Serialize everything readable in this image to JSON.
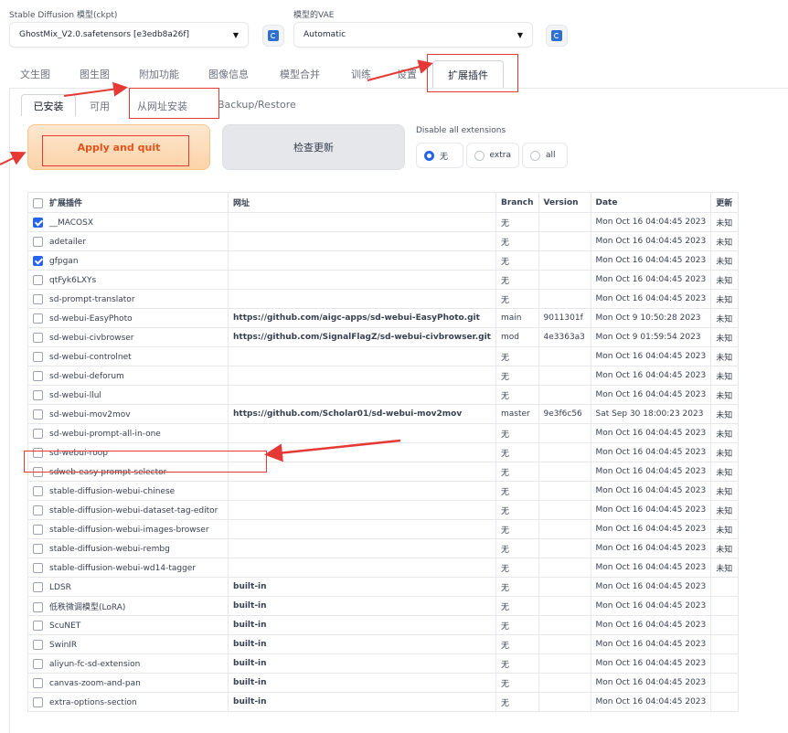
{
  "model_section": {
    "checkpoint_label": "Stable Diffusion 模型(ckpt)",
    "checkpoint_value": "GhostMix_V2.0.safetensors [e3edb8a26f]",
    "vae_label": "模型的VAE",
    "vae_value": "Automatic"
  },
  "main_tabs": [
    "文生图",
    "图生图",
    "附加功能",
    "图像信息",
    "模型合并",
    "训练",
    "设置",
    "扩展插件"
  ],
  "sub_tabs": [
    "已安装",
    "可用",
    "从网址安装",
    "Backup/Restore"
  ],
  "actions": {
    "apply_label": "Apply and quit",
    "check_label": "检查更新"
  },
  "disable_all": {
    "label": "Disable all extensions",
    "options": [
      "无",
      "extra",
      "all"
    ],
    "selected": "无"
  },
  "table": {
    "headers": [
      "扩展插件",
      "网址",
      "Branch",
      "Version",
      "Date",
      "更新"
    ],
    "rows": [
      {
        "name": "__MACOSX",
        "checked": true,
        "url": "",
        "branch": "无",
        "version": "",
        "date": "Mon Oct 16 04:04:45 2023",
        "update": "未知"
      },
      {
        "name": "adetailer",
        "checked": false,
        "url": "",
        "branch": "无",
        "version": "",
        "date": "Mon Oct 16 04:04:45 2023",
        "update": "未知"
      },
      {
        "name": "gfpgan",
        "checked": true,
        "url": "",
        "branch": "无",
        "version": "",
        "date": "Mon Oct 16 04:04:45 2023",
        "update": "未知"
      },
      {
        "name": "qtFyk6LXYs",
        "checked": false,
        "url": "",
        "branch": "无",
        "version": "",
        "date": "Mon Oct 16 04:04:45 2023",
        "update": "未知"
      },
      {
        "name": "sd-prompt-translator",
        "checked": false,
        "url": "",
        "branch": "无",
        "version": "",
        "date": "Mon Oct 16 04:04:45 2023",
        "update": "未知"
      },
      {
        "name": "sd-webui-EasyPhoto",
        "checked": false,
        "url": "https://github.com/aigc-apps/sd-webui-EasyPhoto.git",
        "branch": "main",
        "version": "9011301f",
        "date": "Mon Oct 9 10:50:28 2023",
        "update": "未知"
      },
      {
        "name": "sd-webui-civbrowser",
        "checked": false,
        "url": "https://github.com/SignalFlagZ/sd-webui-civbrowser.git",
        "branch": "mod",
        "version": "4e3363a3",
        "date": "Mon Oct 9 01:59:54 2023",
        "update": "未知"
      },
      {
        "name": "sd-webui-controlnet",
        "checked": false,
        "url": "",
        "branch": "无",
        "version": "",
        "date": "Mon Oct 16 04:04:45 2023",
        "update": "未知"
      },
      {
        "name": "sd-webui-deforum",
        "checked": false,
        "url": "",
        "branch": "无",
        "version": "",
        "date": "Mon Oct 16 04:04:45 2023",
        "update": "未知"
      },
      {
        "name": "sd-webui-llul",
        "checked": false,
        "url": "",
        "branch": "无",
        "version": "",
        "date": "Mon Oct 16 04:04:45 2023",
        "update": "未知"
      },
      {
        "name": "sd-webui-mov2mov",
        "checked": false,
        "url": "https://github.com/Scholar01/sd-webui-mov2mov",
        "branch": "master",
        "version": "9e3f6c56",
        "date": "Sat Sep 30 18:00:23 2023",
        "update": "未知"
      },
      {
        "name": "sd-webui-prompt-all-in-one",
        "checked": false,
        "url": "",
        "branch": "无",
        "version": "",
        "date": "Mon Oct 16 04:04:45 2023",
        "update": "未知"
      },
      {
        "name": "sd-webui-roop",
        "checked": false,
        "url": "",
        "branch": "无",
        "version": "",
        "date": "Mon Oct 16 04:04:45 2023",
        "update": "未知"
      },
      {
        "name": "sdweb-easy-prompt-selector",
        "checked": false,
        "url": "",
        "branch": "无",
        "version": "",
        "date": "Mon Oct 16 04:04:45 2023",
        "update": "未知"
      },
      {
        "name": "stable-diffusion-webui-chinese",
        "checked": false,
        "url": "",
        "branch": "无",
        "version": "",
        "date": "Mon Oct 16 04:04:45 2023",
        "update": "未知"
      },
      {
        "name": "stable-diffusion-webui-dataset-tag-editor",
        "checked": false,
        "url": "",
        "branch": "无",
        "version": "",
        "date": "Mon Oct 16 04:04:45 2023",
        "update": "未知"
      },
      {
        "name": "stable-diffusion-webui-images-browser",
        "checked": false,
        "url": "",
        "branch": "无",
        "version": "",
        "date": "Mon Oct 16 04:04:45 2023",
        "update": "未知"
      },
      {
        "name": "stable-diffusion-webui-rembg",
        "checked": false,
        "url": "",
        "branch": "无",
        "version": "",
        "date": "Mon Oct 16 04:04:45 2023",
        "update": "未知"
      },
      {
        "name": "stable-diffusion-webui-wd14-tagger",
        "checked": false,
        "url": "",
        "branch": "无",
        "version": "",
        "date": "Mon Oct 16 04:04:45 2023",
        "update": "未知"
      },
      {
        "name": "LDSR",
        "checked": false,
        "url": "built-in",
        "branch": "无",
        "version": "",
        "date": "Mon Oct 16 04:04:45 2023",
        "update": ""
      },
      {
        "name": "低秩微调模型(LoRA)",
        "checked": false,
        "url": "built-in",
        "branch": "无",
        "version": "",
        "date": "Mon Oct 16 04:04:45 2023",
        "update": ""
      },
      {
        "name": "ScuNET",
        "checked": false,
        "url": "built-in",
        "branch": "无",
        "version": "",
        "date": "Mon Oct 16 04:04:45 2023",
        "update": ""
      },
      {
        "name": "SwinIR",
        "checked": false,
        "url": "built-in",
        "branch": "无",
        "version": "",
        "date": "Mon Oct 16 04:04:45 2023",
        "update": ""
      },
      {
        "name": "aliyun-fc-sd-extension",
        "checked": false,
        "url": "built-in",
        "branch": "无",
        "version": "",
        "date": "Mon Oct 16 04:04:45 2023",
        "update": ""
      },
      {
        "name": "canvas-zoom-and-pan",
        "checked": false,
        "url": "built-in",
        "branch": "无",
        "version": "",
        "date": "Mon Oct 16 04:04:45 2023",
        "update": ""
      },
      {
        "name": "extra-options-section",
        "checked": false,
        "url": "built-in",
        "branch": "无",
        "version": "",
        "date": "Mon Oct 16 04:04:45 2023",
        "update": ""
      }
    ]
  },
  "colors": {
    "accent_blue": "#2563eb",
    "apply_text": "#e0531d",
    "annotation_red": "#e53935"
  }
}
